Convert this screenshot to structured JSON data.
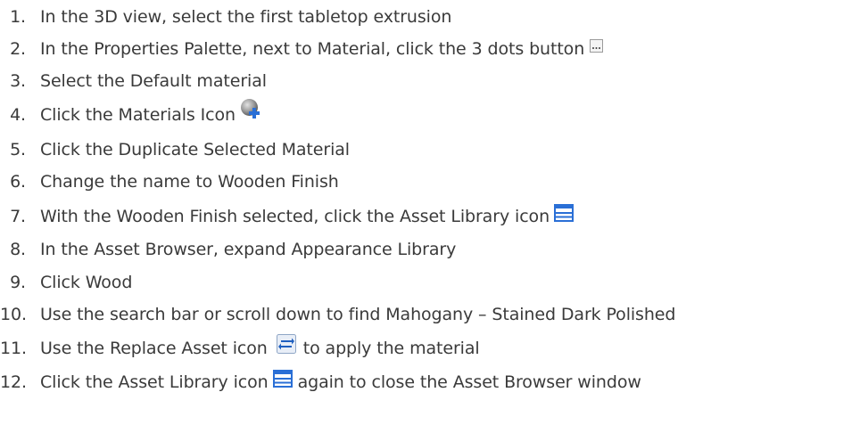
{
  "steps": [
    {
      "number": "1.",
      "text": "In the 3D view, select the first tabletop extrusion"
    },
    {
      "number": "2.",
      "text": "In the Properties Palette, next to Material, click the 3 dots button",
      "icon": "ellipsis-button-icon"
    },
    {
      "number": "3.",
      "text": "Select the Default material"
    },
    {
      "number": "4.",
      "text": "Click the Materials Icon",
      "icon": "materials-add-icon"
    },
    {
      "number": "5.",
      "text": "Click the Duplicate Selected Material"
    },
    {
      "number": "6.",
      "text": "Change the name to Wooden Finish"
    },
    {
      "number": "7.",
      "text": "With the Wooden Finish selected, click the Asset Library icon",
      "icon": "asset-library-icon"
    },
    {
      "number": "8.",
      "text": "In the Asset Browser, expand Appearance Library"
    },
    {
      "number": "9.",
      "text": "Click Wood"
    },
    {
      "number": "10.",
      "text": "Use the search bar or scroll down to find Mahogany – Stained Dark Polished"
    },
    {
      "number": "11.",
      "text": "Use the Replace Asset icon",
      "icon": "replace-asset-icon",
      "trailing_text": "to apply the material"
    },
    {
      "number": "12.",
      "text": "Click the Asset Library icon",
      "icon": "asset-library-icon",
      "trailing_text": "again to close the Asset Browser window"
    }
  ],
  "colors": {
    "text": "#3a3a3a",
    "icon_blue": "#2a6fd6",
    "icon_sphere": "#8e8e8e"
  }
}
